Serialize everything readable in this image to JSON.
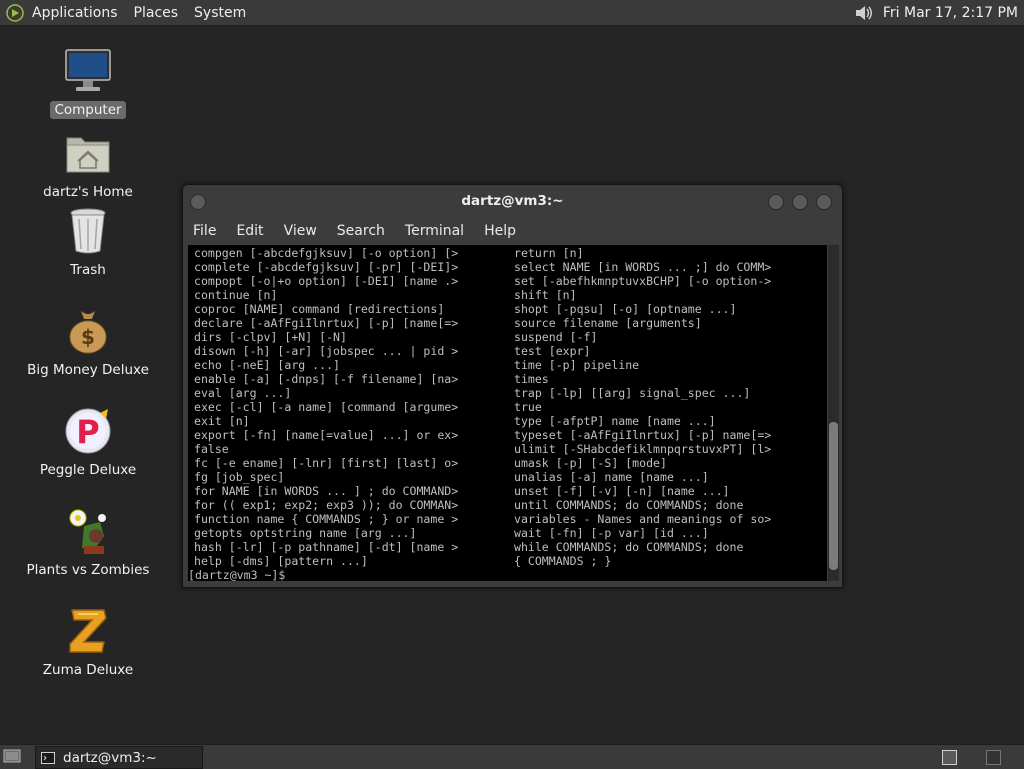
{
  "top_panel": {
    "menus": [
      "Applications",
      "Places",
      "System"
    ],
    "clock": "Fri Mar 17,  2:17 PM"
  },
  "desktop": {
    "icons": [
      {
        "label": "Computer",
        "icon": "computer-icon",
        "selected": true
      },
      {
        "label": "dartz's Home",
        "icon": "home-folder-icon"
      },
      {
        "label": "Trash",
        "icon": "trash-icon"
      },
      {
        "label": "Big Money Deluxe",
        "icon": "money-bag-icon"
      },
      {
        "label": "Peggle Deluxe",
        "icon": "peggle-icon"
      },
      {
        "label": "Plants vs Zombies",
        "icon": "plants-vs-zombies-icon"
      },
      {
        "label": "Zuma Deluxe",
        "icon": "zuma-icon"
      }
    ]
  },
  "terminal": {
    "title": "dartz@vm3:~",
    "menu": [
      "File",
      "Edit",
      "View",
      "Search",
      "Terminal",
      "Help"
    ],
    "lines": [
      [
        "compgen [-abcdefgjksuv] [-o option] [>",
        "return [n]"
      ],
      [
        "complete [-abcdefgjksuv] [-pr] [-DEI]>",
        "select NAME [in WORDS ... ;] do COMM>"
      ],
      [
        "compopt [-o|+o option] [-DEI] [name .>",
        "set [-abefhkmnptuvxBCHP] [-o option->"
      ],
      [
        "continue [n]",
        "shift [n]"
      ],
      [
        "coproc [NAME] command [redirections]",
        "shopt [-pqsu] [-o] [optname ...]"
      ],
      [
        "declare [-aAfFgiIlnrtux] [-p] [name[=>",
        "source filename [arguments]"
      ],
      [
        "dirs [-clpv] [+N] [-N]",
        "suspend [-f]"
      ],
      [
        "disown [-h] [-ar] [jobspec ... | pid >",
        "test [expr]"
      ],
      [
        "echo [-neE] [arg ...]",
        "time [-p] pipeline"
      ],
      [
        "enable [-a] [-dnps] [-f filename] [na>",
        "times"
      ],
      [
        "eval [arg ...]",
        "trap [-lp] [[arg] signal_spec ...]"
      ],
      [
        "exec [-cl] [-a name] [command [argume>",
        "true"
      ],
      [
        "exit [n]",
        "type [-afptP] name [name ...]"
      ],
      [
        "export [-fn] [name[=value] ...] or ex>",
        "typeset [-aAfFgiIlnrtux] [-p] name[=>"
      ],
      [
        "false",
        "ulimit [-SHabcdefiklmnpqrstuvxPT] [l>"
      ],
      [
        "fc [-e ename] [-lnr] [first] [last] o>",
        "umask [-p] [-S] [mode]"
      ],
      [
        "fg [job_spec]",
        "unalias [-a] name [name ...]"
      ],
      [
        "for NAME [in WORDS ... ] ; do COMMAND>",
        "unset [-f] [-v] [-n] [name ...]"
      ],
      [
        "for (( exp1; exp2; exp3 )); do COMMAN>",
        "until COMMANDS; do COMMANDS; done"
      ],
      [
        "function name { COMMANDS ; } or name >",
        "variables - Names and meanings of so>"
      ],
      [
        "getopts optstring name [arg ...]",
        "wait [-fn] [-p var] [id ...]"
      ],
      [
        "hash [-lr] [-p pathname] [-dt] [name >",
        "while COMMANDS; do COMMANDS; done"
      ],
      [
        "help [-dms] [pattern ...]",
        "{ COMMANDS ; }"
      ]
    ],
    "prompt": "[dartz@vm3 ~]$",
    "scroll_position": 0.95
  },
  "bottom_panel": {
    "task_label": "dartz@vm3:~",
    "workspaces": 2
  }
}
